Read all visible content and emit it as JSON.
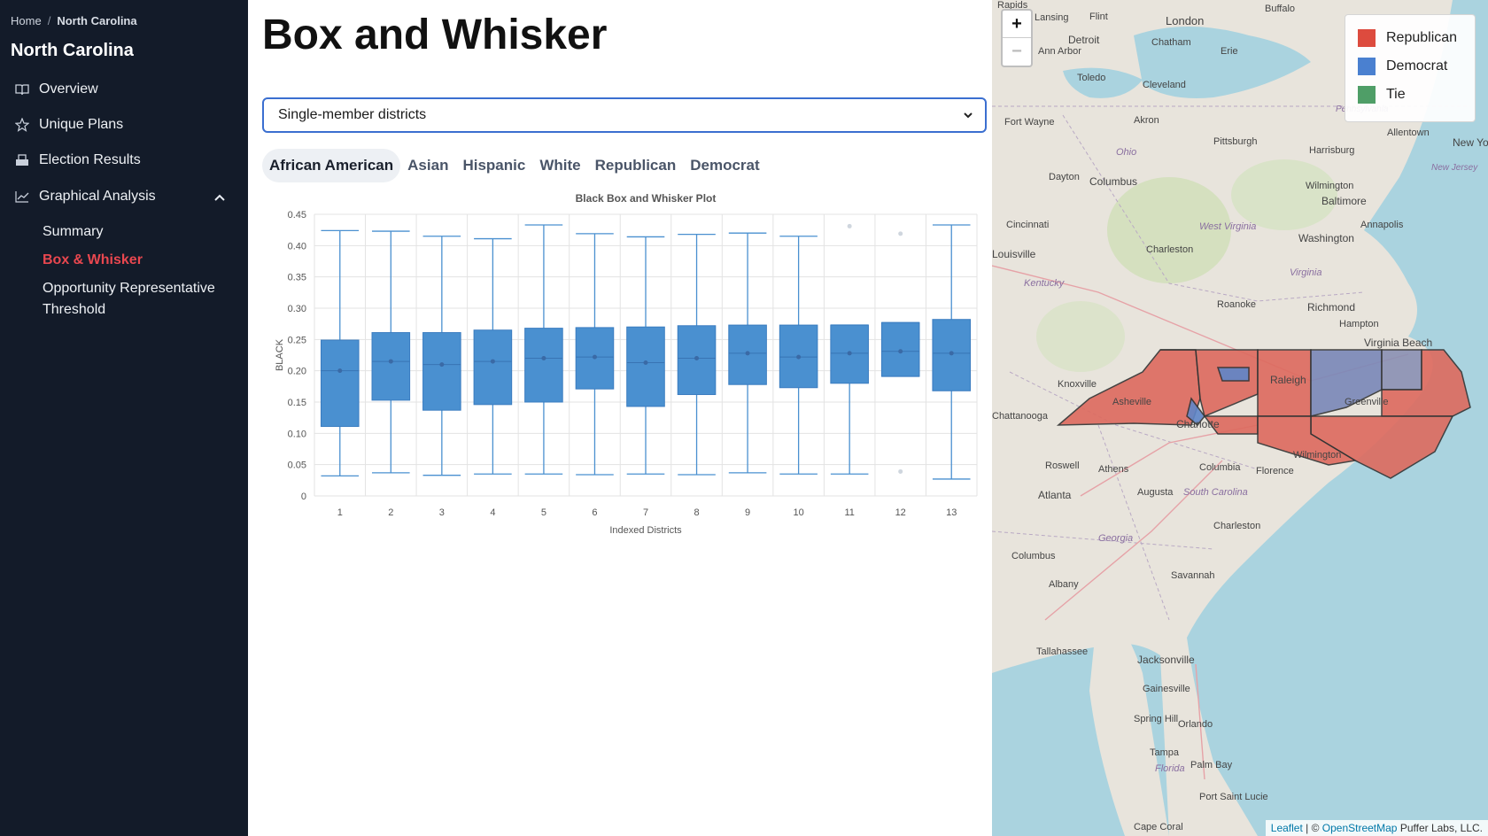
{
  "sidebar": {
    "breadcrumb": {
      "home": "Home",
      "separator": "/",
      "current": "North Carolina"
    },
    "state_title": "North Carolina",
    "items": [
      {
        "label": "Overview",
        "icon": "book-icon"
      },
      {
        "label": "Unique Plans",
        "icon": "star-icon"
      },
      {
        "label": "Election Results",
        "icon": "ballot-box-icon"
      },
      {
        "label": "Graphical Analysis",
        "icon": "line-chart-icon",
        "expanded": true
      }
    ],
    "subitems": [
      {
        "label": "Summary"
      },
      {
        "label": "Box & Whisker",
        "active": true
      },
      {
        "label": "Opportunity Representative Threshold"
      }
    ]
  },
  "main": {
    "title": "Box and Whisker",
    "select": {
      "value": "Single-member districts"
    },
    "tabs": [
      {
        "label": "African American",
        "active": true
      },
      {
        "label": "Asian"
      },
      {
        "label": "Hispanic"
      },
      {
        "label": "White"
      },
      {
        "label": "Republican"
      },
      {
        "label": "Democrat"
      }
    ]
  },
  "chart_data": {
    "type": "box",
    "title": "Black Box and Whisker Plot",
    "xlabel": "Indexed Districts",
    "ylabel": "BLACK",
    "ylim": [
      0,
      0.45
    ],
    "yticks": [
      0,
      0.05,
      0.1,
      0.15,
      0.2,
      0.25,
      0.3,
      0.35,
      0.4,
      0.45
    ],
    "ytick_labels": [
      "0",
      "0.05",
      "0.10",
      "0.15",
      "0.20",
      "0.25",
      "0.30",
      "0.35",
      "0.40",
      "0.45"
    ],
    "categories": [
      "1",
      "2",
      "3",
      "4",
      "5",
      "6",
      "7",
      "8",
      "9",
      "10",
      "11",
      "12",
      "13"
    ],
    "color": "#4a90d0",
    "grid": true,
    "boxes": [
      {
        "min": 0.032,
        "q1": 0.111,
        "median": 0.2,
        "q3": 0.249,
        "max": 0.424
      },
      {
        "min": 0.037,
        "q1": 0.153,
        "median": 0.215,
        "q3": 0.261,
        "max": 0.423
      },
      {
        "min": 0.033,
        "q1": 0.137,
        "median": 0.21,
        "q3": 0.261,
        "max": 0.415
      },
      {
        "min": 0.035,
        "q1": 0.146,
        "median": 0.215,
        "q3": 0.265,
        "max": 0.411
      },
      {
        "min": 0.035,
        "q1": 0.15,
        "median": 0.22,
        "q3": 0.268,
        "max": 0.433
      },
      {
        "min": 0.034,
        "q1": 0.171,
        "median": 0.222,
        "q3": 0.269,
        "max": 0.419
      },
      {
        "min": 0.035,
        "q1": 0.143,
        "median": 0.213,
        "q3": 0.27,
        "max": 0.414
      },
      {
        "min": 0.034,
        "q1": 0.162,
        "median": 0.22,
        "q3": 0.272,
        "max": 0.418
      },
      {
        "min": 0.037,
        "q1": 0.178,
        "median": 0.228,
        "q3": 0.273,
        "max": 0.42
      },
      {
        "min": 0.035,
        "q1": 0.173,
        "median": 0.222,
        "q3": 0.273,
        "max": 0.415
      },
      {
        "min": 0.035,
        "q1": 0.18,
        "median": 0.228,
        "q3": 0.273,
        "max": 0.273,
        "outliers": [
          0.431
        ]
      },
      {
        "min": 0.191,
        "q1": 0.191,
        "median": 0.231,
        "q3": 0.277,
        "max": 0.277,
        "outliers": [
          0.419,
          0.039
        ]
      },
      {
        "min": 0.027,
        "q1": 0.168,
        "median": 0.228,
        "q3": 0.282,
        "max": 0.433
      }
    ]
  },
  "map": {
    "zoom_in": "+",
    "zoom_out": "−",
    "legend": [
      {
        "label": "Republican",
        "color": "#dd4b3e"
      },
      {
        "label": "Democrat",
        "color": "#4a80d0"
      },
      {
        "label": "Tie",
        "color": "#4f9e67"
      }
    ],
    "attribution": {
      "leaflet": "Leaflet",
      "sep": " | © ",
      "osm": "OpenStreetMap",
      "owner": " Puffer Labs, LLC."
    },
    "labels": [
      "Lansing",
      "Flint",
      "London",
      "Buffalo",
      "Detroit",
      "Chatham",
      "Ann Arbor",
      "Erie",
      "Toledo",
      "Cleveland",
      "Fort Wayne",
      "Akron",
      "Pittsburgh",
      "Ohio",
      "Harrisburg",
      "Allentown",
      "New York",
      "Dayton",
      "Columbus",
      "Baltimore",
      "Cincinnati",
      "Annapolis",
      "Washington",
      "West Virginia",
      "Charleston",
      "Pennsylvania",
      "Louisville",
      "Kentucky",
      "Virginia",
      "Roanoke",
      "Richmond",
      "Hampton",
      "Virginia Beach",
      "Knoxville",
      "Asheville",
      "Raleigh",
      "Greenville",
      "Chattanooga",
      "Charlotte",
      "Wilmington",
      "Roswell",
      "Athens",
      "Columbia",
      "Florence",
      "Atlanta",
      "Augusta",
      "South Carolina",
      "Charleston",
      "Georgia",
      "Columbus",
      "Savannah",
      "Albany",
      "Tallahassee",
      "Jacksonville",
      "Gainesville",
      "Orlando",
      "Tampa",
      "Florida",
      "Palm Bay",
      "Port Saint Lucie",
      "Cape Coral",
      "Spring Hill",
      "Wilmington",
      "New Jersey"
    ]
  }
}
